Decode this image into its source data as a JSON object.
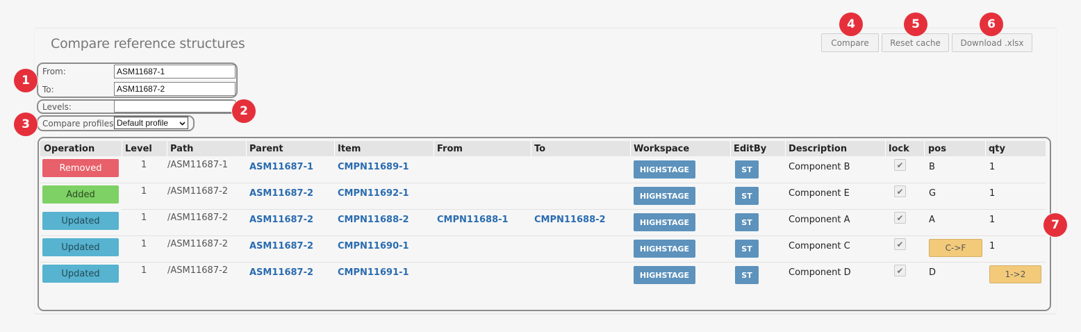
{
  "page": {
    "title": "Compare reference structures"
  },
  "toolbar": {
    "compare_label": "Compare",
    "reset_cache_label": "Reset cache",
    "download_label": "Download .xlsx"
  },
  "form": {
    "from_label": "From:",
    "from_value": "ASM11687-1",
    "to_label": "To:",
    "to_value": "ASM11687-2",
    "levels_label": "Levels:",
    "levels_value": "",
    "profiles_label": "Compare profiles",
    "profile_selected": "Default profile"
  },
  "badges": [
    "1",
    "2",
    "3",
    "4",
    "5",
    "6",
    "7"
  ],
  "table": {
    "columns": [
      "Operation",
      "Level",
      "Path",
      "Parent",
      "Item",
      "From",
      "To",
      "Workspace",
      "EditBy",
      "Description",
      "lock",
      "pos",
      "qty"
    ],
    "rows": [
      {
        "operation": "Removed",
        "level": "1",
        "path": "/ASM11687-1",
        "parent": "ASM11687-1",
        "item": "CMPN11689-1",
        "from": "",
        "to": "",
        "workspace": "HIGHSTAGE",
        "editby": "ST",
        "description": "Component B",
        "locked": true,
        "pos": "B",
        "qty": "1"
      },
      {
        "operation": "Added",
        "level": "1",
        "path": "/ASM11687-2",
        "parent": "ASM11687-2",
        "item": "CMPN11692-1",
        "from": "",
        "to": "",
        "workspace": "HIGHSTAGE",
        "editby": "ST",
        "description": "Component E",
        "locked": true,
        "pos": "G",
        "qty": "1"
      },
      {
        "operation": "Updated",
        "level": "1",
        "path": "/ASM11687-2",
        "parent": "ASM11687-2",
        "item": "CMPN11688-2",
        "from": "CMPN11688-1",
        "to": "CMPN11688-2",
        "workspace": "HIGHSTAGE",
        "editby": "ST",
        "description": "Component A",
        "locked": true,
        "pos": "A",
        "qty": "1"
      },
      {
        "operation": "Updated",
        "level": "1",
        "path": "/ASM11687-2",
        "parent": "ASM11687-2",
        "item": "CMPN11690-1",
        "from": "",
        "to": "",
        "workspace": "HIGHSTAGE",
        "editby": "ST",
        "description": "Component C",
        "locked": true,
        "pos": "C->F",
        "qty": "1"
      },
      {
        "operation": "Updated",
        "level": "1",
        "path": "/ASM11687-2",
        "parent": "ASM11687-2",
        "item": "CMPN11691-1",
        "from": "",
        "to": "",
        "workspace": "HIGHSTAGE",
        "editby": "ST",
        "description": "Component D",
        "locked": true,
        "pos": "D",
        "qty": "1->2"
      }
    ]
  },
  "colors": {
    "removed": "#e8606a",
    "added": "#7ed164",
    "updated": "#57b3cf",
    "stage_button": "#5c92bc",
    "highlight": "#f2ca7a",
    "badge": "#e5303b",
    "link": "#2a6cb0"
  },
  "icons": {
    "lock_check": "checkmark-icon",
    "select_arrow": "chevron-down-icon"
  }
}
